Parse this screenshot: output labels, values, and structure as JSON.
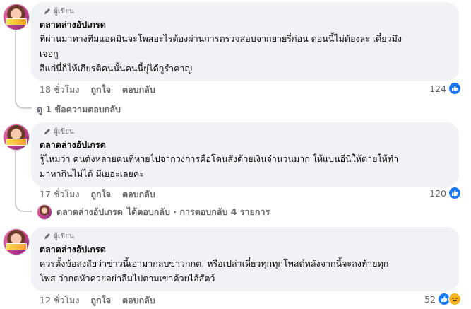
{
  "comments": [
    {
      "badge": "ผู้เขียน",
      "author": "ตลาดล่างอัปเกรด",
      "lines": [
        "ที่ผ่านมาทางทีมแอดมินจะโพสอะไรต้องผ่านการตรวจสอบจากยายรี่ก่อน ตอนนี้ไม่ต้องละ เดี๋ยวมึง",
        "เจอกู",
        "อีแก่นี่ก็ให้เกียรติคนนั้นคนนี้ยุ่ได้กูรำคาญ"
      ],
      "time": "18 ชั่วโมง",
      "like": "ถูกใจ",
      "reply": "ตอบกลับ",
      "reaction_count": "124"
    },
    {
      "badge": "ผู้เขียน",
      "author": "ตลาดล่างอัปเกรด",
      "lines": [
        "รู้ไหมว่า คนดังหลายคนที่หายไปจากวงการคือโดนสั่งด้วยเงินจำนวนมาก ให้แบนอีนี่ให้ตายให้ทำ",
        "มาหากินไม่ได้ มีเยอะเลยคะ"
      ],
      "time": "17 ชั่วโมง",
      "like": "ถูกใจ",
      "reply": "ตอบกลับ",
      "reaction_count": "120"
    },
    {
      "badge": "ผู้เขียน",
      "author": "ตลาดล่างอัปเกรด",
      "lines": [
        "ควรตั้งข้อสงสัยว่าข่าวนี้เอามากลบข่าวกกต. หรือเปล่าเดี๋ยวทุกทุกโพสต์หลังจากนี้จะลงท้ายทุก",
        "โพส ว่ากตหัวควยอย่าลืมไปตามเขาด้วยไอ้สัตว์"
      ],
      "time": "12 ชั่วโมง",
      "like": "ถูกใจ",
      "reply": "ตอบกลับ",
      "reaction_count": "52"
    }
  ],
  "view_replies": "ดู 1 ข้อความตอบกลับ",
  "reply_summary": {
    "name": "ตลาดล่างอัปเกรด",
    "text": "ได้ตอบกลับ · การตอบกลับ 4 รายการ"
  },
  "icons": {
    "like": "like-thumb-icon",
    "haha": "haha-face-icon",
    "badge": "pencil-icon"
  },
  "colors": {
    "bubble": "#f0f2f5",
    "like_blue": "#1877f2",
    "muted": "#65676b"
  }
}
